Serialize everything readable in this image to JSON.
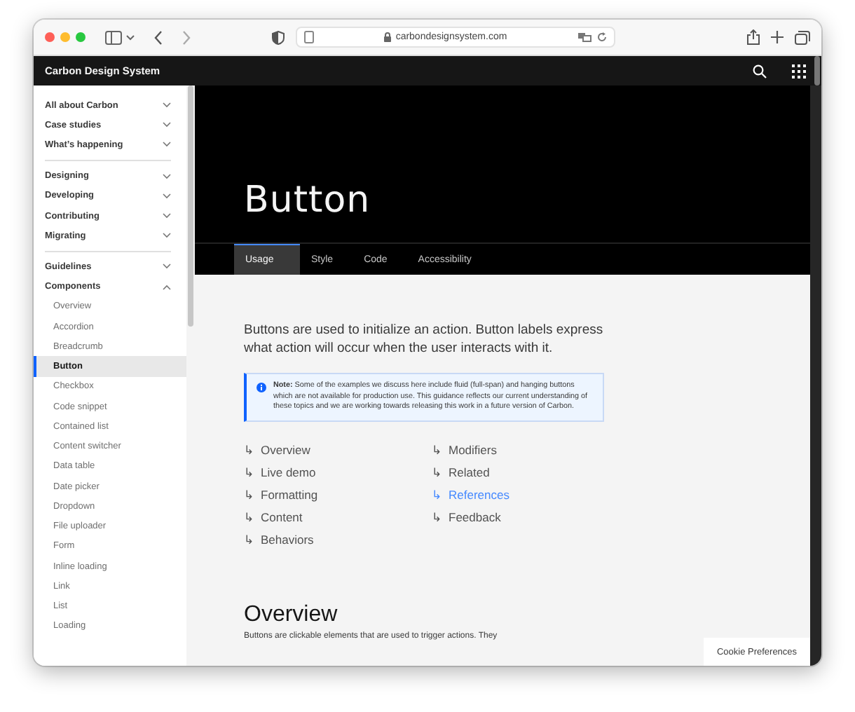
{
  "browser": {
    "url": "carbondesignsystem.com"
  },
  "site_header": {
    "title": "Carbon Design System"
  },
  "sidebar": {
    "groups": [
      {
        "items": [
          {
            "label": "All about Carbon",
            "expanded": false
          },
          {
            "label": "Case studies",
            "expanded": false
          },
          {
            "label": "What’s happening",
            "expanded": false
          }
        ]
      },
      {
        "items": [
          {
            "label": "Designing",
            "expanded": false
          },
          {
            "label": "Developing",
            "expanded": false
          },
          {
            "label": "Contributing",
            "expanded": false
          },
          {
            "label": "Migrating",
            "expanded": false
          }
        ]
      },
      {
        "items": [
          {
            "label": "Guidelines",
            "expanded": false
          },
          {
            "label": "Components",
            "expanded": true,
            "children": [
              {
                "label": "Overview",
                "selected": false
              },
              {
                "label": "Accordion",
                "selected": false
              },
              {
                "label": "Breadcrumb",
                "selected": false
              },
              {
                "label": "Button",
                "selected": true
              },
              {
                "label": "Checkbox",
                "selected": false
              },
              {
                "label": "Code snippet",
                "selected": false
              },
              {
                "label": "Contained list",
                "selected": false
              },
              {
                "label": "Content switcher",
                "selected": false
              },
              {
                "label": "Data table",
                "selected": false
              },
              {
                "label": "Date picker",
                "selected": false
              },
              {
                "label": "Dropdown",
                "selected": false
              },
              {
                "label": "File uploader",
                "selected": false
              },
              {
                "label": "Form",
                "selected": false
              },
              {
                "label": "Inline loading",
                "selected": false
              },
              {
                "label": "Link",
                "selected": false
              },
              {
                "label": "List",
                "selected": false
              },
              {
                "label": "Loading",
                "selected": false
              }
            ]
          }
        ]
      }
    ]
  },
  "hero": {
    "title": "Button",
    "tabs": [
      {
        "label": "Usage",
        "selected": true
      },
      {
        "label": "Style",
        "selected": false
      },
      {
        "label": "Code",
        "selected": false
      },
      {
        "label": "Accessibility",
        "selected": false
      }
    ]
  },
  "intro": "Buttons are used to initialize an action. Button labels express what action will occur when the user interacts with it.",
  "note": "**Note:** Some of the examples we discuss here include fluid (full-span) and hanging buttons which are not available for production use. This guidance reflects our current understanding of these topics and we are working towards releasing this work in a future version of Carbon.",
  "anchor_links": [
    {
      "arrow": "↳",
      "label": "Overview",
      "selected": false
    },
    {
      "arrow": "↳",
      "label": "Live demo",
      "selected": false
    },
    {
      "arrow": "↳",
      "label": "Formatting",
      "selected": false
    },
    {
      "arrow": "↳",
      "label": "Content",
      "selected": false
    },
    {
      "arrow": "↳",
      "label": "Behaviors",
      "selected": false
    },
    {
      "arrow": "↳",
      "label": "Modifiers",
      "selected": false
    },
    {
      "arrow": "↳",
      "label": "Related",
      "selected": false
    },
    {
      "arrow": "↳",
      "label": "References",
      "selected": true
    },
    {
      "arrow": "↳",
      "label": "Feedback",
      "selected": false
    }
  ],
  "section": {
    "heading": "Overview",
    "text": "Buttons are clickable elements that are used to trigger actions. They"
  },
  "cookie_button": "Cookie Preferences"
}
